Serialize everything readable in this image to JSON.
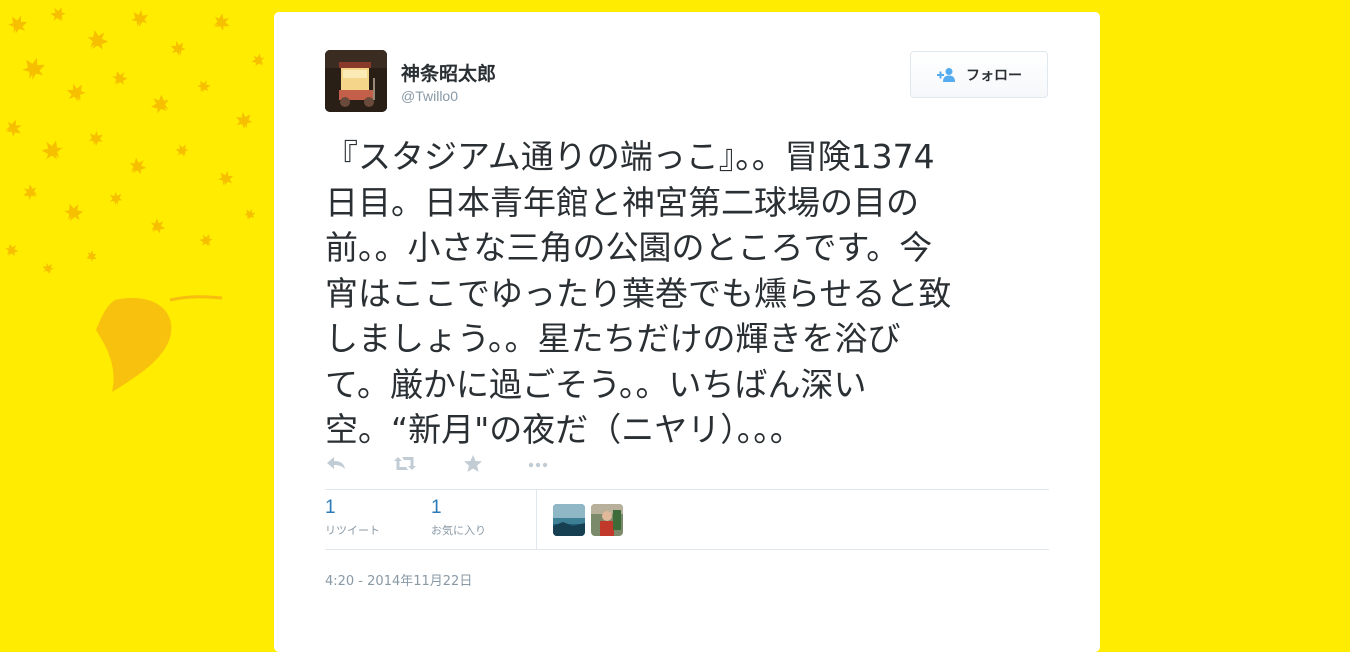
{
  "colors": {
    "page_background": "#ffec00",
    "leaf": "#f5b800",
    "card_background": "#ffffff",
    "text_primary": "#292f33",
    "text_secondary": "#8899a6",
    "link_blue": "#2b7bb9",
    "follow_icon_blue": "#55acee"
  },
  "background_icon": "falling-maple-leaves",
  "user": {
    "display_name": "神条昭太郎",
    "handle": "@Twillo0",
    "avatar_icon": "night-food-cart-photo"
  },
  "follow_button": {
    "label": "フォロー",
    "icon": "add-person-icon"
  },
  "tweet": {
    "lines": [
      "『スタジアム通りの端っこ』。。冒険1374",
      "日目。日本青年館と神宮第二球場の目の",
      "前。。小さな三角の公園のところです。今",
      "宵はここでゆったり葉巻でも燻らせると致",
      "しましょう。。星たちだけの輝きを浴び",
      "て。厳かに過ごそう。。いちばん深い",
      "空。“新月\"の夜だ（ニヤリ）。。。"
    ]
  },
  "actions": [
    {
      "name": "reply-icon"
    },
    {
      "name": "retweet-icon"
    },
    {
      "name": "favorite-star-icon"
    },
    {
      "name": "more-options-icon"
    }
  ],
  "stats": {
    "retweets": {
      "count": "1",
      "label": "リツイート"
    },
    "favorites": {
      "count": "1",
      "label": "お気に入り"
    }
  },
  "favoriters": [
    {
      "name": "favoriter-avatar-1",
      "icon": "seascape-photo"
    },
    {
      "name": "favoriter-avatar-2",
      "icon": "person-photo"
    }
  ],
  "timestamp": "4:20 - 2014年11月22日"
}
